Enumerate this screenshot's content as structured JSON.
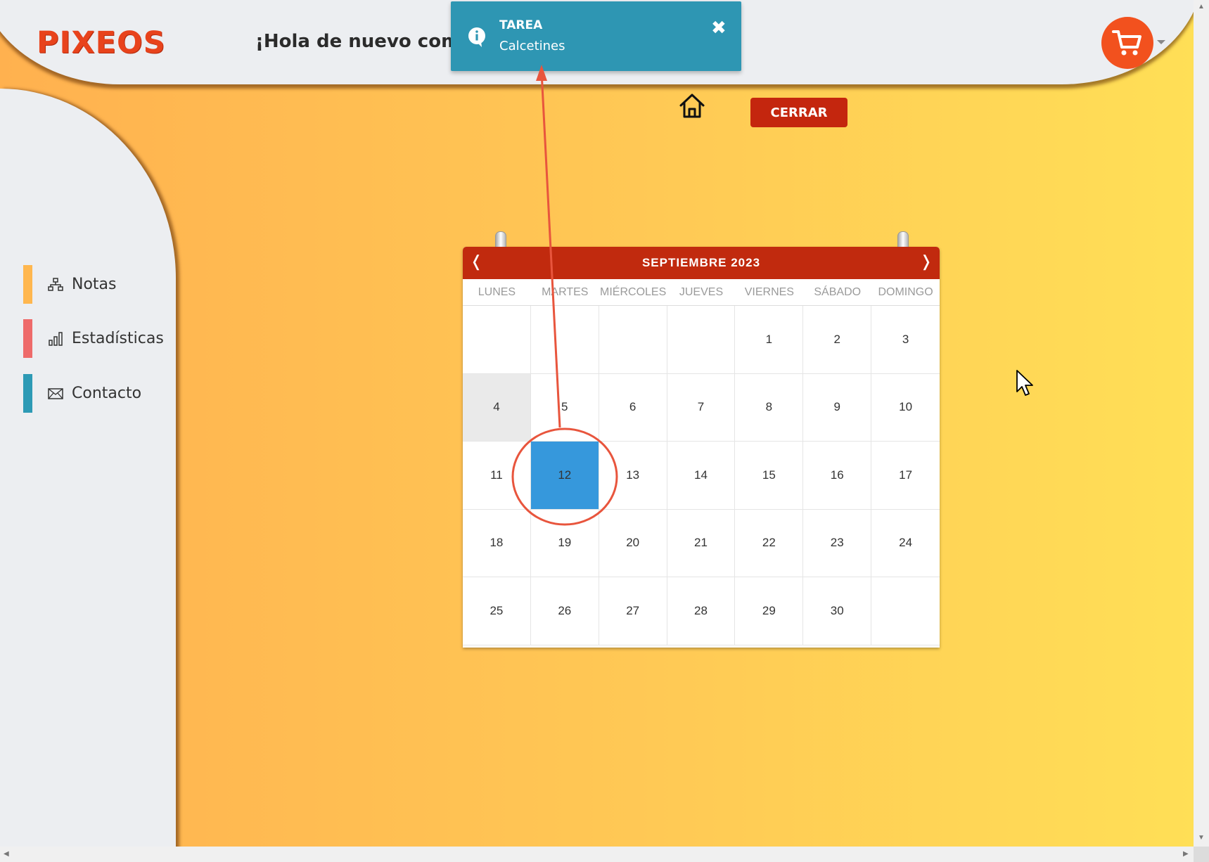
{
  "header": {
    "logo": "PIXEOS",
    "greeting": "¡Hola de nuevo comp"
  },
  "sidebar": {
    "items": [
      {
        "label": "Notas",
        "color": "#ffb74f"
      },
      {
        "label": "Estadísticas",
        "color": "#ee6a6a"
      },
      {
        "label": "Contacto",
        "color": "#2d9ab5"
      }
    ]
  },
  "actions": {
    "close_label": "CERRAR"
  },
  "notification": {
    "title": "TAREA",
    "message": "Calcetines"
  },
  "calendar": {
    "month": "SEPTIEMBRE 2023",
    "prev": "❬",
    "next": "❭",
    "weekdays": [
      "LUNES",
      "MARTES",
      "MIÉRCOLES",
      "JUEVES",
      "VIERNES",
      "SÁBADO",
      "DOMINGO"
    ],
    "weeks": [
      [
        "",
        "",
        "",
        "",
        "1",
        "2",
        "3"
      ],
      [
        "4",
        "5",
        "6",
        "7",
        "8",
        "9",
        "10"
      ],
      [
        "11",
        "12",
        "13",
        "14",
        "15",
        "16",
        "17"
      ],
      [
        "18",
        "19",
        "20",
        "21",
        "22",
        "23",
        "24"
      ],
      [
        "25",
        "26",
        "27",
        "28",
        "29",
        "30",
        ""
      ]
    ],
    "today": "4",
    "selected": "12"
  },
  "colors": {
    "accent": "#c12a0e",
    "selected": "#3698dc",
    "notification": "#2e96b3",
    "annotation": "#e8553d"
  }
}
